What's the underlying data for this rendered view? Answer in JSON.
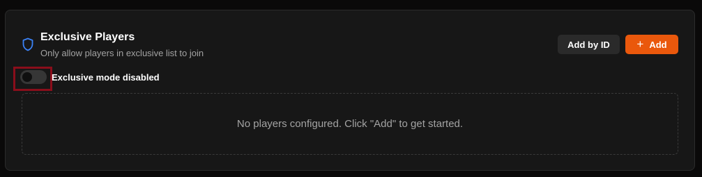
{
  "section": {
    "title": "Exclusive Players",
    "subtitle": "Only allow players in exclusive list to join",
    "icon": "shield-icon"
  },
  "actions": {
    "add_by_id_label": "Add by ID",
    "add_label": "Add",
    "add_icon": "plus-icon"
  },
  "exclusive_mode": {
    "enabled": false,
    "label": "Exclusive mode disabled"
  },
  "players": {
    "items": [],
    "empty_message": "No players configured. Click \"Add\" to get started."
  },
  "colors": {
    "accent": "#ea580c",
    "shield_icon": "#3b82f6",
    "highlight_outline": "#8a0e1b",
    "card_background": "#171717"
  }
}
